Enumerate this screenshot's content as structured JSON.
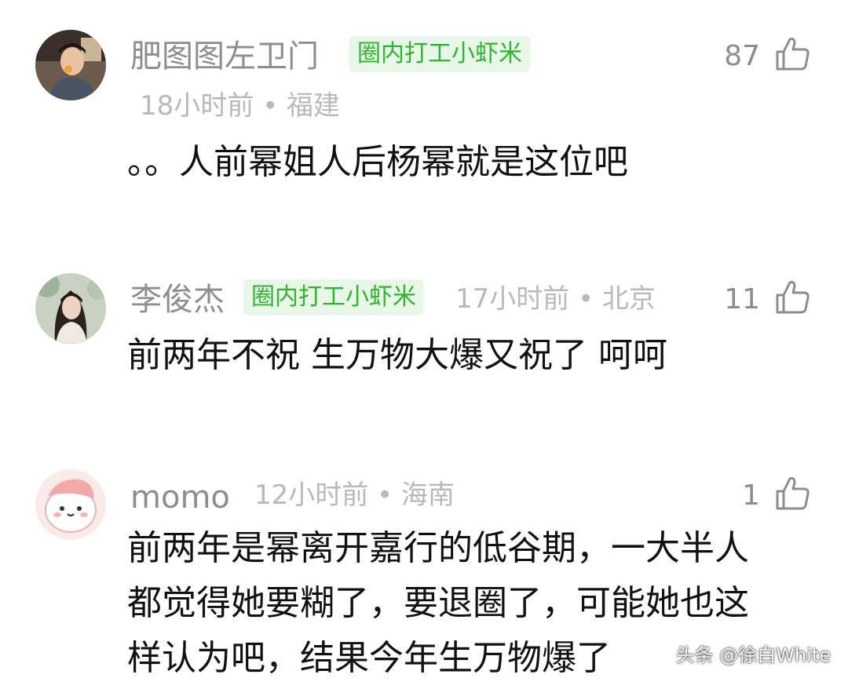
{
  "comments": [
    {
      "username": "肥图图左卫门",
      "badge": "圈内打工小虾米",
      "meta": "18小时前 • 福建",
      "likes": "87",
      "text_lines": [
        "。。人前幂姐人后杨幂就是这位吧"
      ],
      "icon": "thumbs-up-icon"
    },
    {
      "username": "李俊杰",
      "badge": "圈内打工小虾米",
      "meta": "17小时前 • 北京",
      "likes": "11",
      "text_lines": [
        "前两年不祝 生万物大爆又祝了 呵呵"
      ],
      "icon": "thumbs-up-icon"
    },
    {
      "username": "momo",
      "meta": "12小时前 • 海南",
      "likes": "1",
      "text_lines": [
        "前两年是幂离开嘉行的低谷期，一大半人",
        "都觉得她要糊了，要退圈了，可能她也这",
        "样认为吧，结果今年生万物爆了"
      ],
      "icon": "thumbs-up-icon"
    }
  ],
  "watermark": "头条 @徐白White",
  "colors": {
    "badge_bg": "#e9f7e8",
    "badge_text": "#2fb52f",
    "name": "#8d8d8d",
    "meta": "#b9b9b9",
    "body_text": "#111111"
  }
}
